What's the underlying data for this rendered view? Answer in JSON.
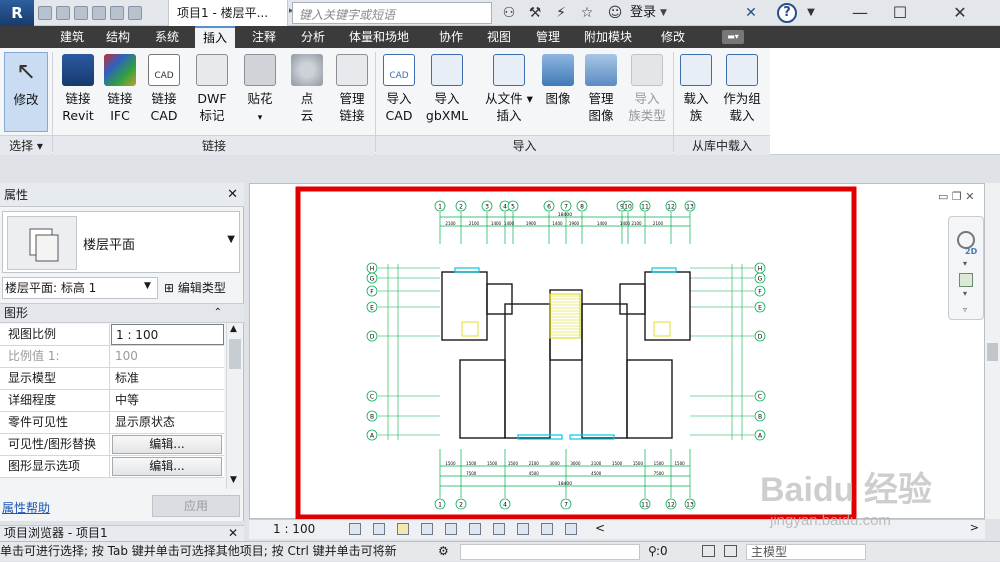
{
  "title_bar": {
    "app_button": "R",
    "document_title": "项目1 - 楼层平...",
    "search_placeholder": "键入关键字或短语",
    "login_label": "登录",
    "help_label": "?",
    "minimize": "—",
    "maximize": "☐",
    "close": "✕"
  },
  "tabs": [
    {
      "label": "建筑"
    },
    {
      "label": "结构"
    },
    {
      "label": "系统"
    },
    {
      "label": "插入"
    },
    {
      "label": "注释"
    },
    {
      "label": "分析"
    },
    {
      "label": "体量和场地"
    },
    {
      "label": "协作"
    },
    {
      "label": "视图"
    },
    {
      "label": "管理"
    },
    {
      "label": "附加模块"
    },
    {
      "label": "修改"
    }
  ],
  "ribbon": {
    "modify": "修改",
    "link_revit": [
      "链接",
      "Revit"
    ],
    "link_ifc": [
      "链接",
      "IFC"
    ],
    "link_cad": [
      "链接",
      "CAD"
    ],
    "dwf": [
      "DWF",
      "标记"
    ],
    "decal": [
      "贴花",
      "▾"
    ],
    "point_cloud": [
      "点",
      "云"
    ],
    "manage_links": [
      "管理",
      "链接"
    ],
    "import_cad": [
      "导入",
      "CAD"
    ],
    "import_gbxml": [
      "导入",
      "gbXML"
    ],
    "insert_from_file": [
      "从文件",
      "插入"
    ],
    "image": "图像",
    "manage_images": [
      "管理",
      "图像"
    ],
    "import_family_types": [
      "导入",
      "族类型"
    ],
    "load_family": [
      "载入",
      "族"
    ],
    "load_as_group": [
      "作为组",
      "载入"
    ],
    "panels": {
      "select": "选择 ▾",
      "link": "链接",
      "import": "导入",
      "load_from_library": "从库中载入"
    }
  },
  "properties": {
    "title": "属性",
    "close": "✕",
    "type_name": "楼层平面",
    "instance_selector": "楼层平面: 标高 1",
    "edit_type": "编辑类型",
    "category": "图形",
    "rows": [
      {
        "name": "视图比例",
        "value": "1 : 100"
      },
      {
        "name": "比例值 1:",
        "value": "100"
      },
      {
        "name": "显示模型",
        "value": "标准"
      },
      {
        "name": "详细程度",
        "value": "中等"
      },
      {
        "name": "零件可见性",
        "value": "显示原状态"
      },
      {
        "name": "可见性/图形替换",
        "value": "编辑..."
      },
      {
        "name": "图形显示选项",
        "value": "编辑..."
      }
    ],
    "help_link": "属性帮助",
    "apply": "应用"
  },
  "project_browser": {
    "title": "项目浏览器 - 项目1",
    "close": "✕"
  },
  "view": {
    "scale": "1 : 100",
    "nav_2d": "2D"
  },
  "drawing": {
    "column_labels": [
      "1",
      "2",
      "3",
      "4",
      "5",
      "6",
      "7",
      "8",
      "9",
      "10",
      "11",
      "12",
      "13"
    ],
    "row_labels": [
      "H",
      "G",
      "F",
      "E",
      "D",
      "C",
      "B",
      "A"
    ],
    "top_dims": [
      "2100",
      "2100",
      "1400",
      "1400",
      "1900",
      "1400",
      "1900",
      "1400",
      "1400",
      "2100",
      "2100"
    ],
    "top_total": "18400",
    "bottom_dims": [
      "1500",
      "1500",
      "1500",
      "1500",
      "2100",
      "3000",
      "3000",
      "2100",
      "1500",
      "1500",
      "1500",
      "1500"
    ],
    "bottom_mid": [
      "7500",
      "4500",
      "4500",
      "7500"
    ],
    "bottom_total": "18400",
    "bottom_axis_labels": [
      "1",
      "2",
      "4",
      "7",
      "11",
      "12",
      "13"
    ],
    "colors": {
      "frame": "#e00000",
      "grid": "#00b050",
      "dims": "#00b050",
      "walls": "#1a1a1a",
      "windows": "#00c8e6",
      "stairs": "#d8d800"
    }
  },
  "status_bar": {
    "text": "单击可进行选择; 按 Tab 键并单击可选择其他项目; 按 Ctrl 键并单击可将新",
    "filter_count": ":0",
    "model": "主模型"
  },
  "watermark": {
    "logo": "Baidu 经验",
    "url": "jingyan.baidu.com"
  }
}
